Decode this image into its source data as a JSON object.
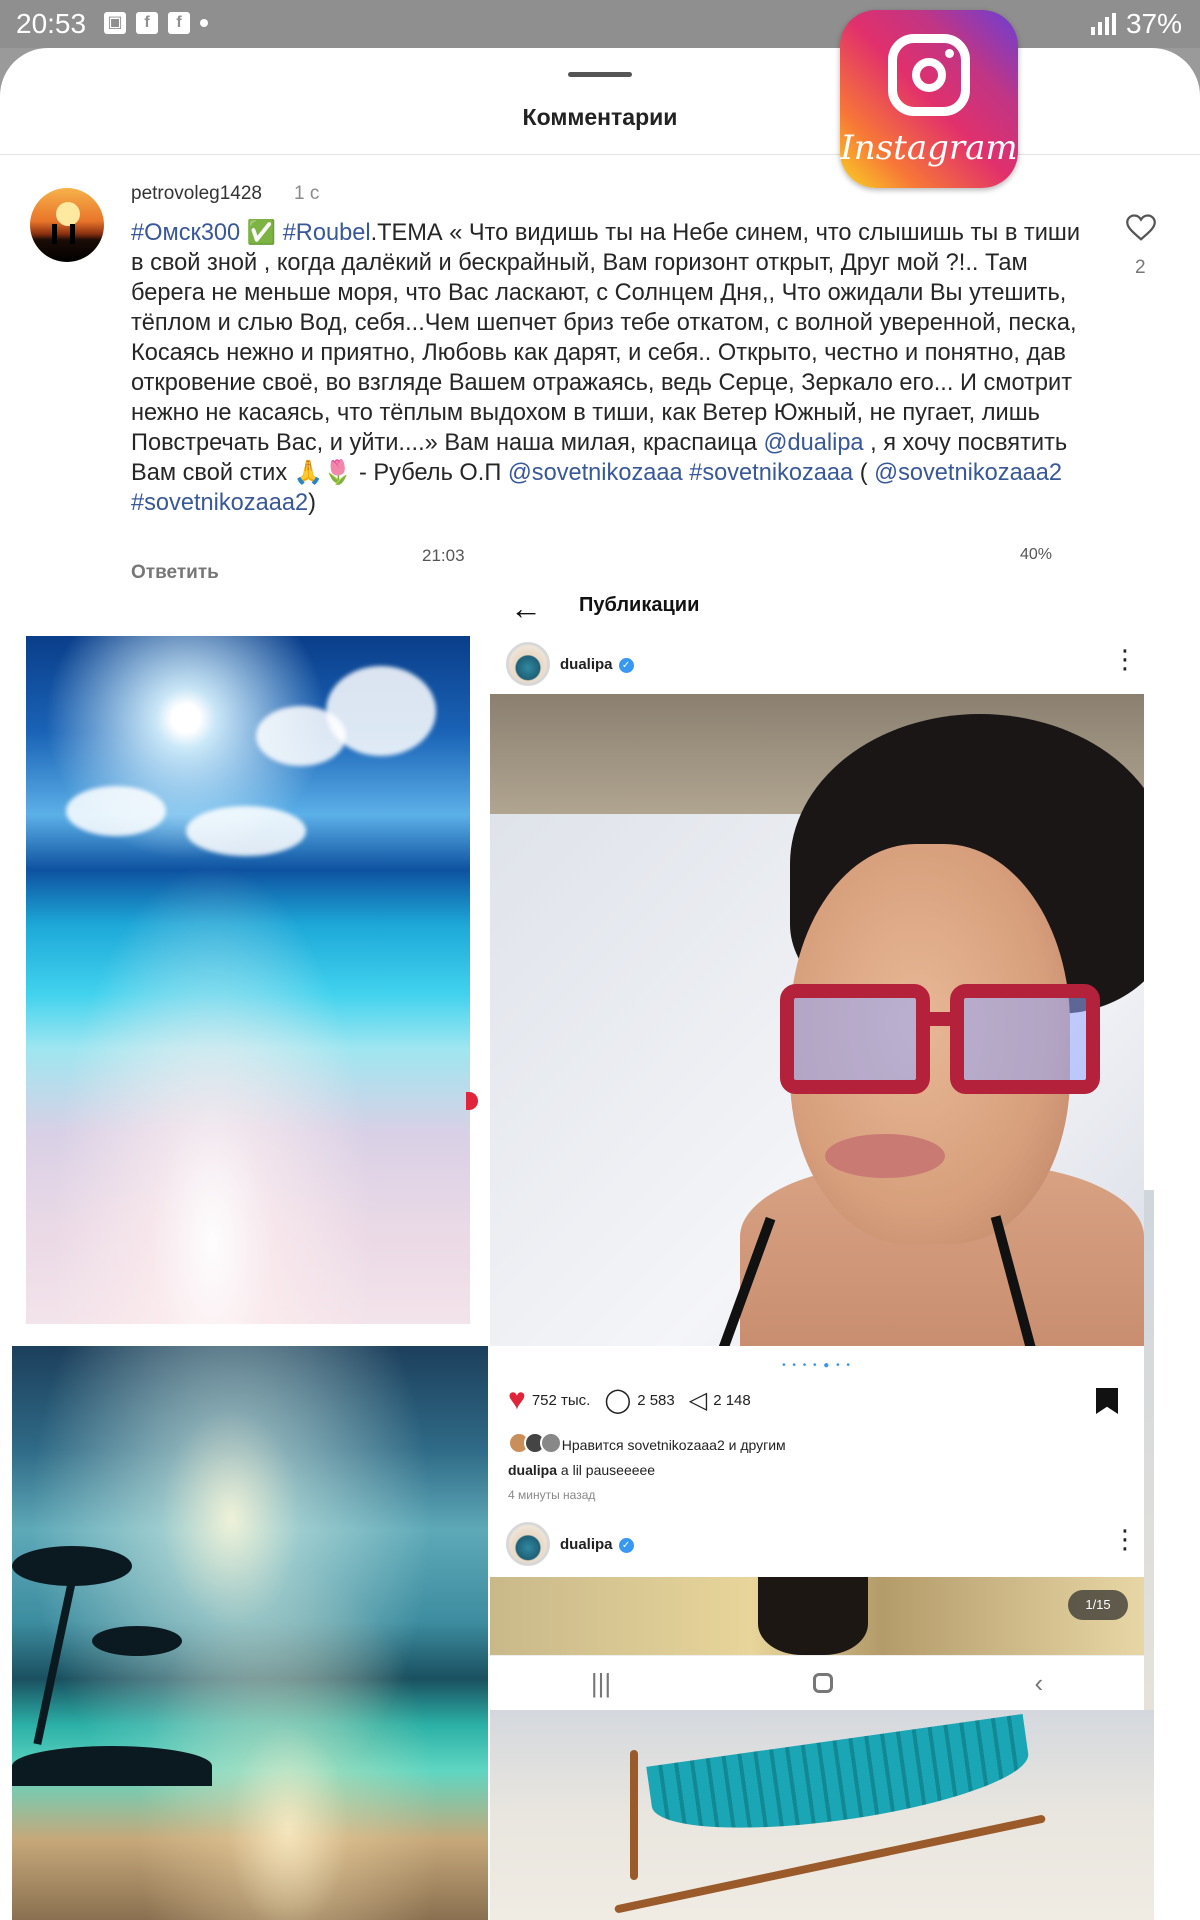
{
  "status_bar": {
    "time": "20:53",
    "battery": "37%"
  },
  "sheet": {
    "title": "Комментарии"
  },
  "logo": {
    "text": "Instagram"
  },
  "comment": {
    "username": "petrovoleg1428",
    "time": "1 с",
    "text_parts": [
      {
        "t": "#Омск300",
        "tag": true
      },
      {
        "t": " ✅ ",
        "tag": false
      },
      {
        "t": "#Roubel",
        "tag": true
      },
      {
        "t": ".ТЕМА « Что видишь ты на Небе синем, что слышишь ты в тиши в свой зной , когда далёкий и бескрайный, Вам горизонт открыт, Друг мой ?!.. Там берега не меньше моря, что Вас ласкают, с Солнцем Дня,, Что ожидали Вы утешить, тёплом и слью Вод, себя...Чем шепчет бриз  тебе откатом, с волной уверенной, песка, Косаясь нежно и приятно, Любовь как дарят, и себя.. Открыто, честно и понятно, дав откровение  своё, во взгляде Вашем отражаясь, ведь Серце, Зеркало его... И смотрит нежно не касаясь, что тёплым выдохом в тиши, как Ветер Южный, не пугает, лишь Повстречать Вас, и уйти....» Вам наша милая, краспаица ",
        "tag": false
      },
      {
        "t": "@dualipa",
        "tag": true
      },
      {
        "t": " , я хочу посвятить Вам свой стих 🙏🌷 - Рубель О.П ",
        "tag": false
      },
      {
        "t": "@sovetnikozaaa",
        "tag": true
      },
      {
        "t": " ",
        "tag": false
      },
      {
        "t": "#sovetnikozaaa",
        "tag": true
      },
      {
        "t": " ( ",
        "tag": false
      },
      {
        "t": "@sovetnikozaaa2",
        "tag": true
      },
      {
        "t": " ",
        "tag": false
      },
      {
        "t": "#sovetnikozaaa2",
        "tag": true
      },
      {
        "t": ")",
        "tag": false
      }
    ],
    "like_count": "2",
    "reply_label": "Ответить"
  },
  "screenshot": {
    "status_time": "21:03",
    "status_battery": "40%",
    "title": "Публикации",
    "post1": {
      "username": "dualipa",
      "likes": "752 тыс.",
      "comments": "2 583",
      "shares": "2 148",
      "liked_by": "Нравится sovetnikozaaa2 и другим",
      "caption_user": "dualipa",
      "caption_text": " a lil pauseeeee",
      "time_ago": "4 минуты назад"
    },
    "post2": {
      "username": "dualipa",
      "counter": "1/15"
    }
  },
  "colors": {
    "link": "#385898",
    "like_red": "#e0243a",
    "verified": "#3897f0"
  }
}
